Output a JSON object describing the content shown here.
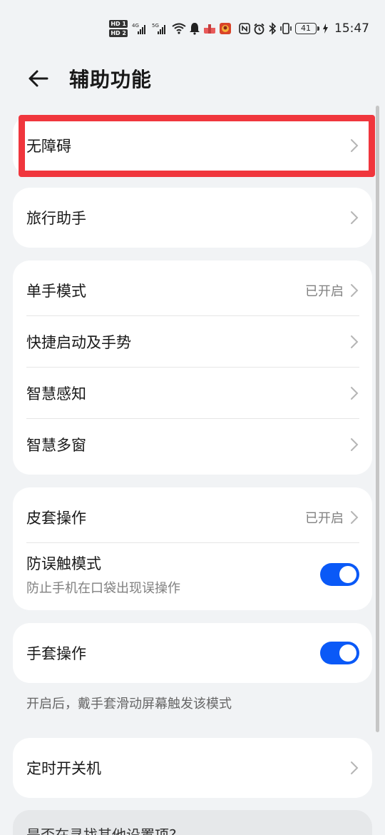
{
  "status_bar": {
    "hd1": "HD 1",
    "hd2": "HD 2",
    "net1": "4G",
    "net2": "5G",
    "battery": "41",
    "time": "15:47",
    "icons": [
      "hd-icon",
      "signal-icon",
      "wifi-icon",
      "notification-icon",
      "app-icon",
      "game-icon",
      "nfc-icon",
      "alarm-icon",
      "bluetooth-icon",
      "vibrate-icon",
      "battery-icon",
      "charging-icon"
    ]
  },
  "header": {
    "title": "辅助功能"
  },
  "cards": {
    "accessibility": {
      "label": "无障碍"
    },
    "travel": {
      "label": "旅行助手"
    },
    "group1": {
      "one_hand": {
        "label": "单手模式",
        "value": "已开启"
      },
      "shortcut": {
        "label": "快捷启动及手势"
      },
      "smart_sense": {
        "label": "智慧感知"
      },
      "multi_window": {
        "label": "智慧多窗"
      }
    },
    "group2": {
      "cover": {
        "label": "皮套操作",
        "value": "已开启"
      },
      "anti_touch": {
        "label": "防误触模式",
        "sub": "防止手机在口袋出现误操作",
        "enabled": true
      }
    },
    "glove": {
      "label": "手套操作",
      "enabled": true
    },
    "glove_hint": "开启后，戴手套滑动屏幕触发该模式",
    "schedule": {
      "label": "定时开关机"
    },
    "bottom_hint": "是否在寻找其他设置项?"
  },
  "colors": {
    "background": "#f1f3f5",
    "toggle_on": "#0a59f7",
    "highlight": "#f0363d"
  }
}
